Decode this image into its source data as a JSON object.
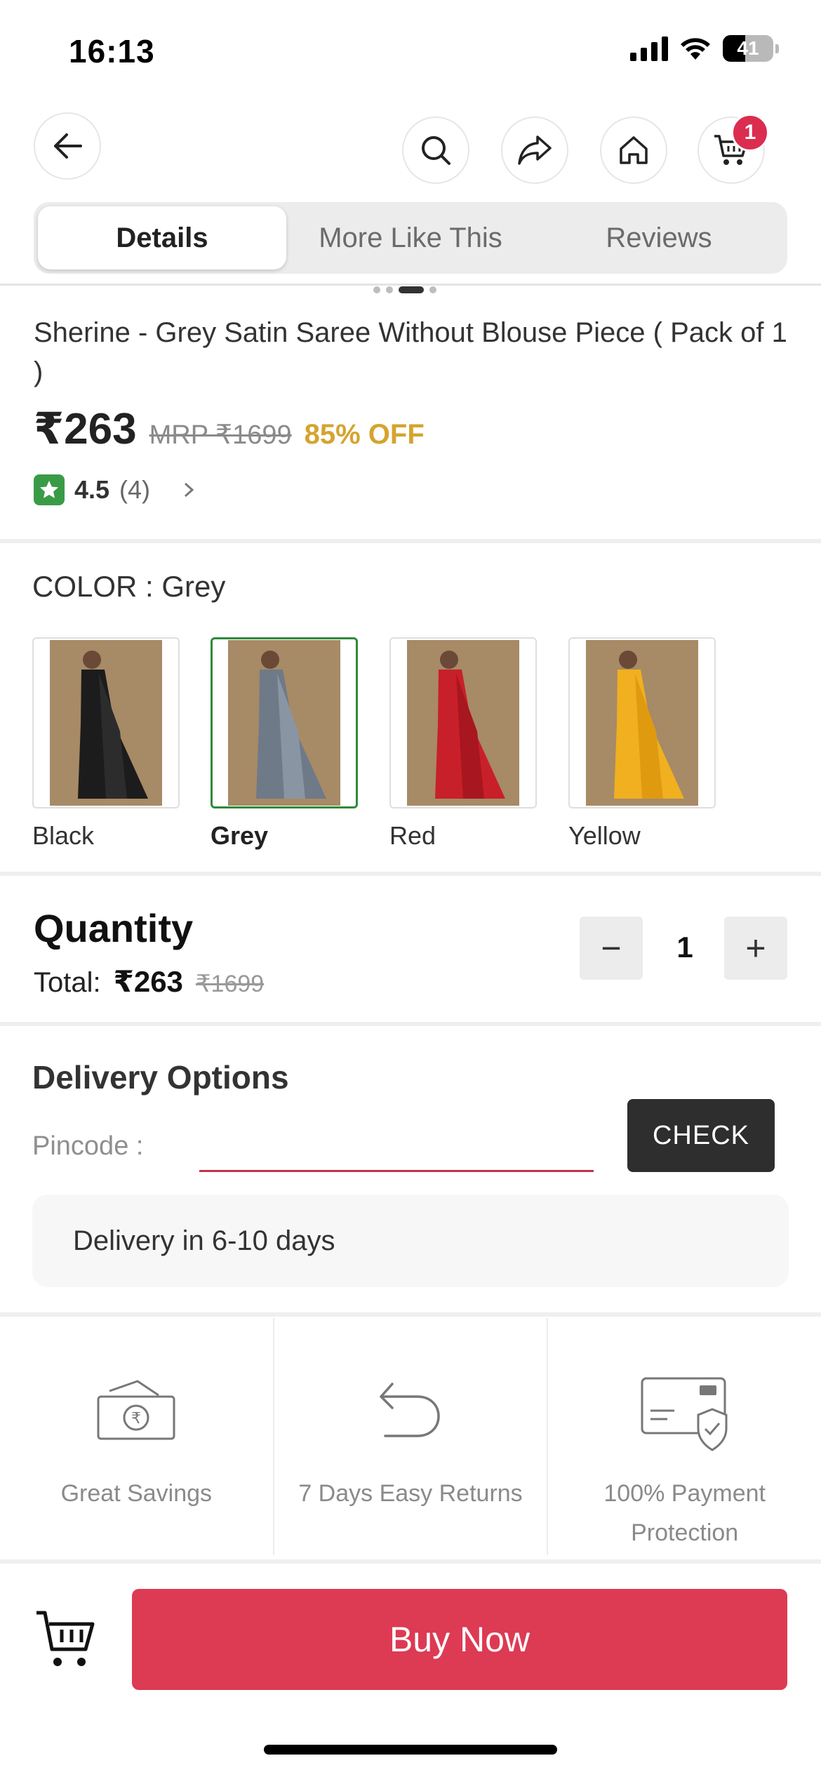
{
  "status_bar": {
    "time": "16:13",
    "battery": "41"
  },
  "cart": {
    "badge_count": "1"
  },
  "tabs": [
    {
      "label": "Details",
      "active": true
    },
    {
      "label": "More Like This",
      "active": false
    },
    {
      "label": "Reviews",
      "active": false
    }
  ],
  "product": {
    "title": "Sherine - Grey Satin Saree Without Blouse Piece ( Pack of 1 )",
    "price": "₹263",
    "mrp": "MRP ₹1699",
    "discount": "85% OFF",
    "rating": "4.5",
    "rating_count": "(4)"
  },
  "color": {
    "label": "COLOR : Grey",
    "options": [
      {
        "name": "Black",
        "saree_color": "#1c1c1c",
        "selected": false
      },
      {
        "name": "Grey",
        "saree_color": "#6f7a88",
        "selected": true
      },
      {
        "name": "Red",
        "saree_color": "#c8202a",
        "selected": false
      },
      {
        "name": "Yellow",
        "saree_color": "#f0b020",
        "selected": false
      }
    ]
  },
  "quantity": {
    "title": "Quantity",
    "total_label": "Total:",
    "total_amount": "₹263",
    "total_mrp": "₹1699",
    "value": "1",
    "minus": "−",
    "plus": "+"
  },
  "delivery": {
    "title": "Delivery Options",
    "pincode_label": "Pincode :",
    "pincode_value": "",
    "check_label": "CHECK",
    "estimate": "Delivery in 6-10 days"
  },
  "features": [
    {
      "icon": "cash-savings-icon",
      "label": "Great Savings"
    },
    {
      "icon": "return-arrow-icon",
      "label": "7 Days Easy Returns"
    },
    {
      "icon": "payment-shield-icon",
      "label": "100% Payment Protection"
    }
  ],
  "footer": {
    "buy_label": "Buy Now"
  },
  "colors": {
    "brand": "#dd3a54",
    "accent_gold": "#d4a42f",
    "rating_green": "#3a9b47"
  }
}
